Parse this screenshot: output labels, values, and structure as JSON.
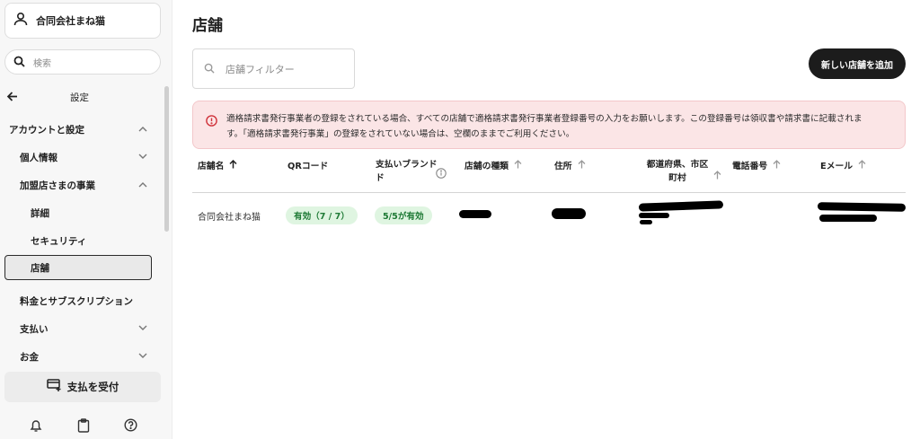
{
  "sidebar": {
    "account_name": "合同会社まね猫",
    "search_placeholder": "検索",
    "back_title": "設定",
    "items": [
      {
        "label": "アカウントと設定",
        "chevron": "up"
      },
      {
        "label": "個人情報",
        "chevron": "down"
      },
      {
        "label": "加盟店さまの事業",
        "chevron": "up"
      },
      {
        "label": "詳細"
      },
      {
        "label": "セキュリティ"
      },
      {
        "label": "店舗",
        "active": true
      },
      {
        "label": "料金とサブスクリプション"
      },
      {
        "label": "支払い",
        "chevron": "down"
      },
      {
        "label": "お金",
        "chevron": "down"
      }
    ],
    "pay_button": "支払を受付",
    "bottom_icons": [
      "bell-icon",
      "clipboard-icon",
      "help-icon"
    ]
  },
  "main": {
    "title": "店舗",
    "filter_placeholder": "店舗フィルター",
    "add_button": "新しい店舗を追加",
    "alert": {
      "line1": "適格請求書発行事業者の登録をされている場合、すべての店舗で適格請求書発行事業者登録番号の入力をお願いします。この登録番号は領収書や請求書に記載されま",
      "line2": "す。「適格請求書発行事業」の登録をされていない場合は、空欄のままでご利用ください。"
    },
    "table": {
      "headers": {
        "name": "店舗名",
        "qr": "QRコード",
        "brand_line1": "支払いブランド",
        "brand_line2": "ド",
        "type": "店舗の種類",
        "address": "住所",
        "pref_line1": "都道府県、市区",
        "pref_line2": "町村",
        "phone": "電話番号",
        "email": "Eメール"
      },
      "rows": [
        {
          "name": "合同会社まね猫",
          "qr": "有効（7 / 7）",
          "brand": "5/5が有効"
        }
      ]
    }
  },
  "colors": {
    "alert_bg": "#fbe5e6",
    "alert_icon": "#d0323a",
    "pill_bg": "#dff5e1",
    "pill_text": "#1e7a35",
    "primary_button": "#1c1c1c"
  }
}
